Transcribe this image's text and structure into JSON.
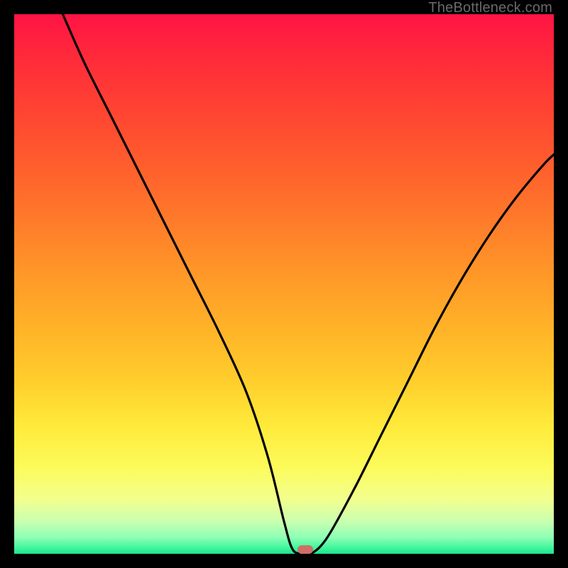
{
  "watermark": "TheBottleneck.com",
  "chart_data": {
    "type": "line",
    "title": "",
    "xlabel": "",
    "ylabel": "",
    "xlim": [
      0,
      100
    ],
    "ylim": [
      0,
      100
    ],
    "background_gradient": {
      "top_color": "#ff1445",
      "mid_color": "#ffce2c",
      "bottom_color": "#1de28e",
      "meaning": "red = high bottleneck %, green = 0% bottleneck"
    },
    "series": [
      {
        "name": "bottleneck-curve",
        "x": [
          9,
          13,
          18,
          23,
          28,
          33,
          38,
          43,
          47,
          50,
          51.5,
          53,
          55,
          58,
          63,
          68,
          73,
          78,
          83,
          88,
          93,
          98,
          100
        ],
        "y": [
          100,
          91,
          81,
          71,
          61,
          51,
          41,
          30,
          18,
          6,
          1,
          0,
          0,
          3,
          12,
          22,
          32,
          42,
          51,
          59,
          66,
          72,
          74
        ]
      }
    ],
    "marker": {
      "x": 54,
      "y": 0.5,
      "label": "optimal-point"
    }
  },
  "colors": {
    "curve": "#000000",
    "marker": "#cf6e66",
    "frame": "#000000"
  }
}
